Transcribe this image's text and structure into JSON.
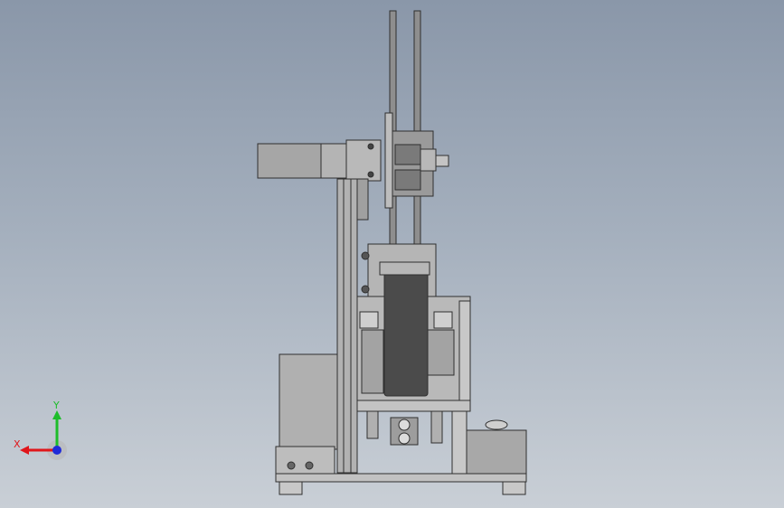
{
  "viewport": {
    "background_top": "#8a97a9",
    "background_bottom": "#c9cfd6"
  },
  "model": {
    "body_color": "#a9a9a9",
    "edge_color": "#2f2f2f",
    "dark_part_color": "#4b4b4b",
    "light_part_color": "#c4c4c4"
  },
  "triad": {
    "x_label": "X",
    "y_label": "Y",
    "x_color": "#e0161a",
    "y_color": "#1dbd2a",
    "z_color": "#1f2bd8"
  }
}
